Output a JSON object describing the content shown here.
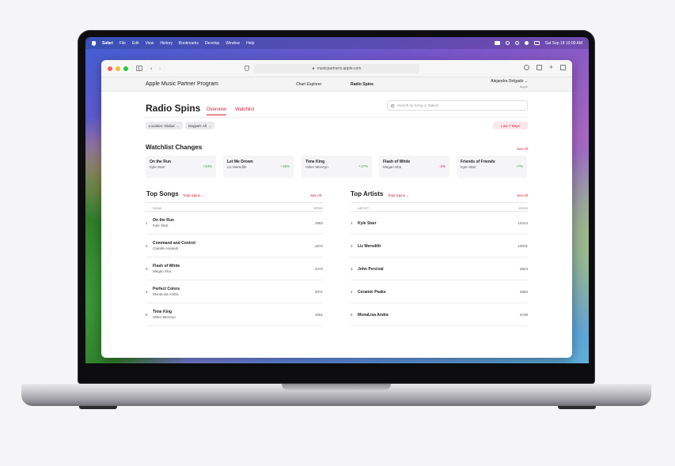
{
  "menubar": {
    "items": [
      "Safari",
      "File",
      "Edit",
      "View",
      "History",
      "Bookmarks",
      "Develop",
      "Window",
      "Help"
    ],
    "clock": "Sat Sep 18  10:00 AM"
  },
  "browser": {
    "url": "musicpartners.apple.com"
  },
  "site": {
    "title": "Apple Music Partner Program",
    "nav": {
      "chart_explorer": "Chart Explorer",
      "radio_spins": "Radio Spins"
    },
    "user": {
      "name": "Alejandra Delgado",
      "org": "Apple"
    }
  },
  "page": {
    "title": "Radio Spins",
    "tabs": {
      "overview": "Overview",
      "watchlist": "Watchlist"
    },
    "search_placeholder": "Search by Song or Station",
    "filters": {
      "location": "Location: Global",
      "daypart": "Daypart: All",
      "range": "Last 7 Days"
    }
  },
  "watchlist": {
    "title": "Watchlist Changes",
    "see_all": "See All",
    "cards": [
      {
        "title": "On the Run",
        "artist": "Kyle Starr",
        "change": "+34%"
      },
      {
        "title": "Let Me Drown",
        "artist": "Liz Meredith",
        "change": "+18%"
      },
      {
        "title": "Time King",
        "artist": "Other Mervryn",
        "change": "+17%"
      },
      {
        "title": "Flash of White",
        "artist": "Megan Sha",
        "change": "-2%"
      },
      {
        "title": "Friends of Friends",
        "artist": "Kyle Starr",
        "change": "+7%"
      }
    ]
  },
  "top_songs": {
    "title": "Top Songs",
    "sort": "Total Spins",
    "see_all": "See All",
    "col_song": "SONG",
    "col_spins": "SPINS",
    "rows": [
      {
        "rank": "1",
        "title": "On the Run",
        "artist": "Kyle Starr",
        "spins": "2882"
      },
      {
        "rank": "2",
        "title": "Command and Control",
        "artist": "Camille Assandi",
        "spins": "2672"
      },
      {
        "rank": "3",
        "title": "Flash of White",
        "artist": "Megan Sha",
        "spins": "2472"
      },
      {
        "rank": "4",
        "title": "Perfect Colors",
        "artist": "MonaLisa Andra",
        "spins": "2071"
      },
      {
        "rank": "5",
        "title": "Time King",
        "artist": "Other Mervryn",
        "spins": "1851"
      }
    ]
  },
  "top_artists": {
    "title": "Top Artists",
    "sort": "Total Spins",
    "see_all": "See All",
    "col_artist": "ARTIST",
    "col_spins": "SPINS",
    "rows": [
      {
        "rank": "1",
        "name": "Kyle Starr",
        "spins": "10413"
      },
      {
        "rank": "2",
        "name": "Liz Meredith",
        "spins": "10031"
      },
      {
        "rank": "3",
        "name": "John Percival",
        "spins": "6823"
      },
      {
        "rank": "4",
        "name": "Ceramic Peaks",
        "spins": "6084"
      },
      {
        "rank": "5",
        "name": "MonaLisa Andra",
        "spins": "5748"
      }
    ]
  },
  "colors": {
    "accent": "#d4213b",
    "positive": "#2e9b3f",
    "traffic_close": "#ff5f57",
    "traffic_min": "#febc2e",
    "traffic_max": "#28c840"
  }
}
